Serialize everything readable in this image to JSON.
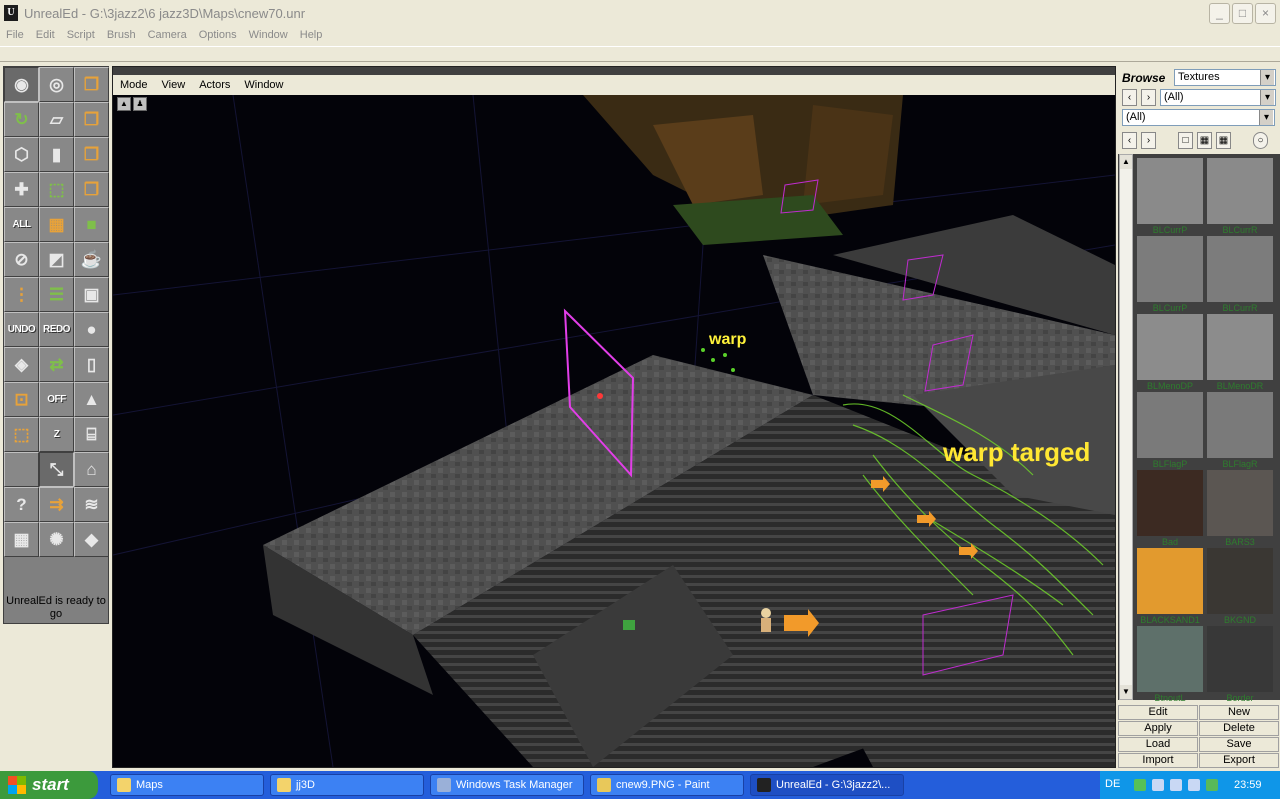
{
  "window": {
    "title": "UnrealEd - G:\\3jazz2\\6 jazz3D\\Maps\\cnew70.unr",
    "controls": [
      "minimize",
      "maximize",
      "close"
    ]
  },
  "menu": [
    "File",
    "Edit",
    "Script",
    "Brush",
    "Camera",
    "Options",
    "Window",
    "Help"
  ],
  "toolbox": {
    "status": "UnrealEd is ready to go",
    "labels": {
      "all": "ALL",
      "undo": "UNDO",
      "redo": "REDO",
      "off": "OFF",
      "z": "Z"
    }
  },
  "viewport": {
    "menu": [
      "Mode",
      "View",
      "Actors",
      "Window"
    ],
    "annotations": {
      "warp": "warp",
      "warp_target": "warp targed"
    }
  },
  "browser": {
    "label": "Browse",
    "type": "Textures",
    "package": "(All)",
    "group": "(All)",
    "textures": [
      "BLCurrP",
      "BLCurrR",
      "BLCurrP",
      "BLCurrR",
      "BLMenoDP",
      "BLMenoDR",
      "BLFlagP",
      "BLFlagR",
      "Bad",
      "BARS3",
      "BLACKSAND1",
      "BKGND",
      "BtnoutL",
      "Border"
    ],
    "buttons": [
      "Edit",
      "New",
      "Apply",
      "Delete",
      "Load",
      "Save",
      "Import",
      "Export"
    ]
  },
  "taskbar": {
    "start": "start",
    "tasks": [
      "Maps",
      "jj3D",
      "Windows Task Manager",
      "cnew9.PNG - Paint",
      "UnrealEd - G:\\3jazz2\\..."
    ],
    "language": "DE",
    "time": "23:59"
  }
}
